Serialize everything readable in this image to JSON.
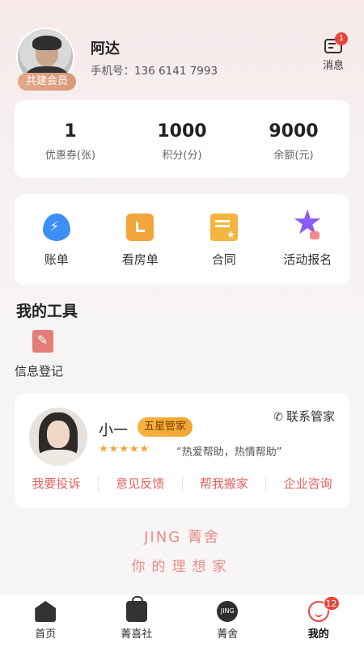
{
  "profile": {
    "name": "阿达",
    "phone": "手机号：136 6141 7993",
    "member_badge": "共建会员"
  },
  "messages": {
    "label": "消息",
    "badge": "1"
  },
  "stats": [
    {
      "value": "1",
      "label": "优惠券(张)"
    },
    {
      "value": "1000",
      "label": "积分(分)"
    },
    {
      "value": "9000",
      "label": "余额(元)"
    }
  ],
  "quick": [
    {
      "label": "账单",
      "icon": "drop-icon"
    },
    {
      "label": "看房单",
      "icon": "house-icon"
    },
    {
      "label": "合同",
      "icon": "contract-icon"
    },
    {
      "label": "活动报名",
      "icon": "star-icon"
    }
  ],
  "tools": {
    "title": "我的工具",
    "items": [
      {
        "label": "信息登记",
        "icon": "edit-icon"
      }
    ]
  },
  "steward": {
    "name": "小一",
    "badge": "五星管家",
    "contact_label": "联系管家",
    "stars": "★★★★★",
    "quote": "“热爱帮助，热情帮助”",
    "actions": [
      "我要投诉",
      "意见反馈",
      "帮我搬家",
      "企业咨询"
    ]
  },
  "brand": {
    "logo": "JING 菁舍",
    "slogan": "你的理想家"
  },
  "tabbar": {
    "tabs": [
      {
        "label": "首页"
      },
      {
        "label": "菁喜社"
      },
      {
        "label": "菁舍",
        "icon_text": "JING"
      },
      {
        "label": "我的",
        "badge": "12"
      }
    ]
  },
  "colors": {
    "accent": "#e0625c",
    "badge_red": "#e8443c",
    "gold": "#f3a533"
  }
}
